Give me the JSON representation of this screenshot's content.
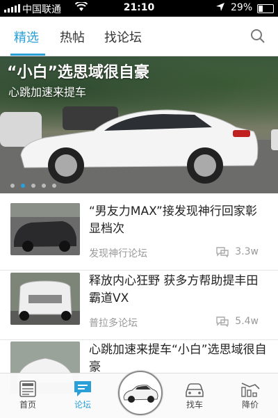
{
  "status": {
    "carrier": "中国联通",
    "time": "21:10",
    "battery": "29%"
  },
  "tabs": [
    {
      "label": "精选",
      "active": true
    },
    {
      "label": "热帖",
      "active": false
    },
    {
      "label": "找论坛",
      "active": false
    }
  ],
  "banner": {
    "title": "“小白”选思域很自豪",
    "subtitle": "心跳加速来提车",
    "slide_count": 5,
    "active_slide": 2
  },
  "articles": [
    {
      "title": "“男友力MAX”接发现神行回家彰显档次",
      "forum": "发现神行论坛",
      "views": "3.3w"
    },
    {
      "title": "释放内心狂野 获多方帮助提丰田霸道VX",
      "forum": "普拉多论坛",
      "views": "5.4w"
    },
    {
      "title": "心跳加速来提车“小白”选思域很自豪",
      "forum": "",
      "views": ""
    }
  ],
  "bottom_nav": [
    {
      "label": "首页",
      "icon": "news-icon",
      "active": false
    },
    {
      "label": "论坛",
      "icon": "chat-icon",
      "active": true
    },
    {
      "label": "",
      "icon": "car-photo",
      "active": false
    },
    {
      "label": "找车",
      "icon": "car-icon",
      "active": false
    },
    {
      "label": "降价",
      "icon": "price-drop-icon",
      "active": false
    }
  ],
  "colors": {
    "accent": "#2a9fd8"
  }
}
